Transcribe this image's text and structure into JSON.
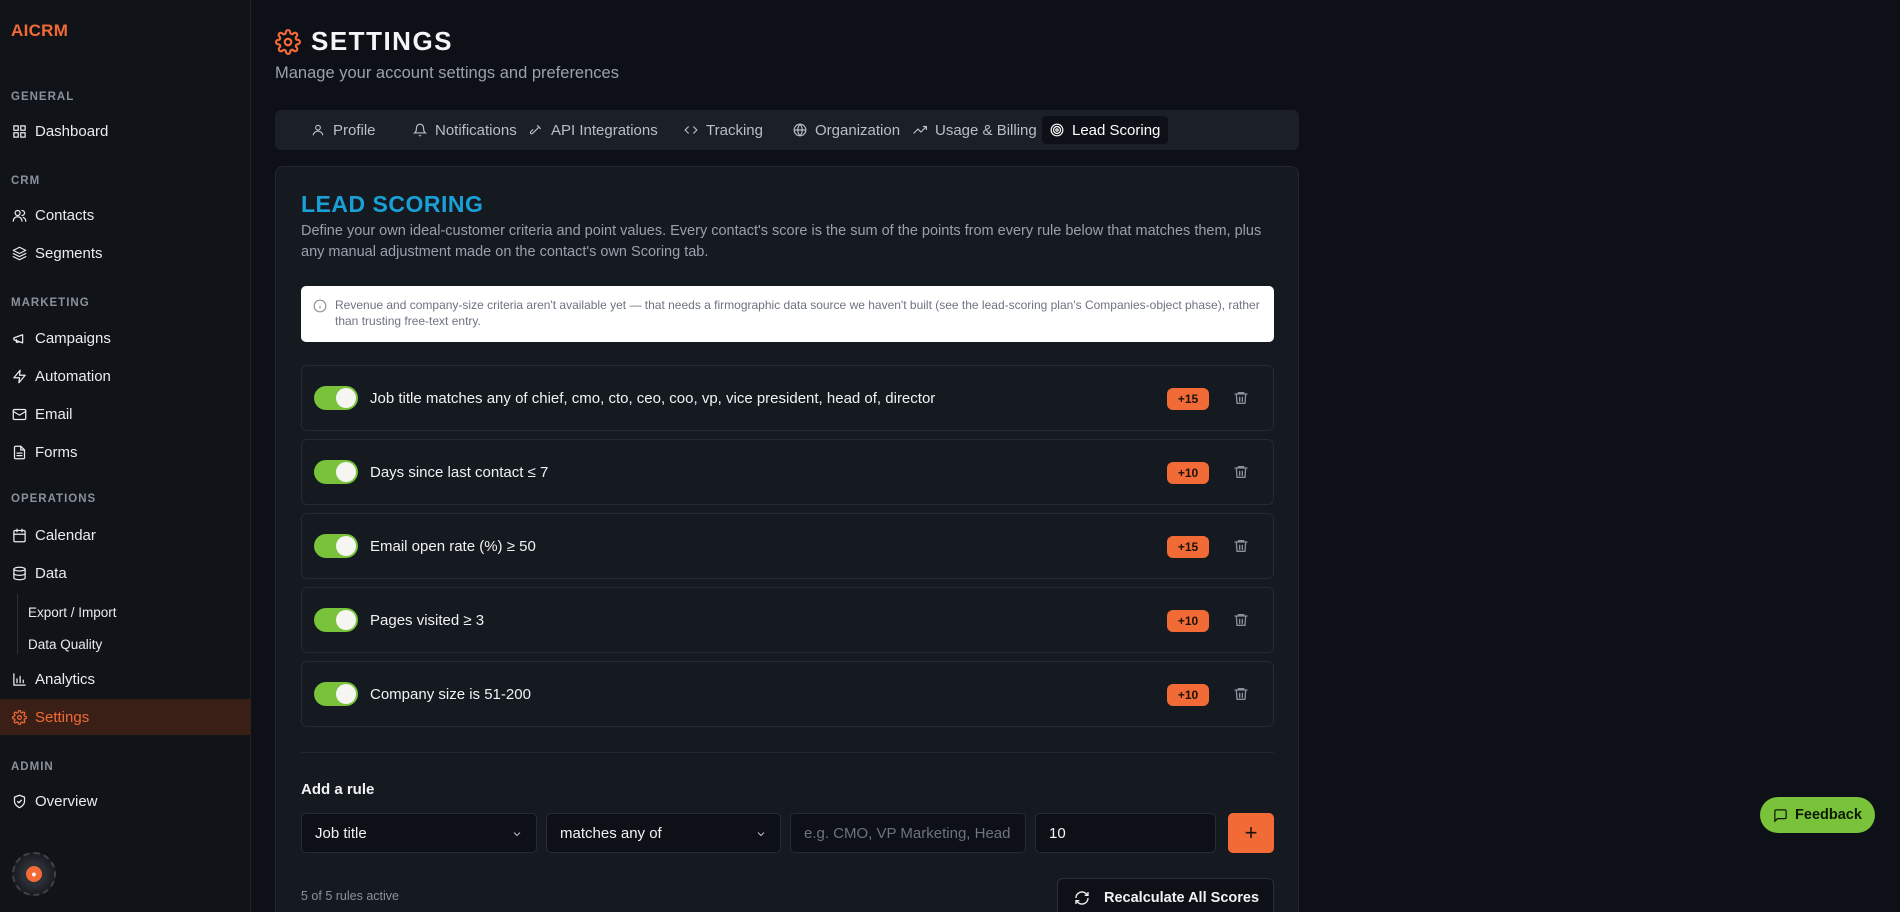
{
  "app": {
    "brand": "AICRM"
  },
  "sidebar": {
    "sections": {
      "general": "GENERAL",
      "crm": "CRM",
      "marketing": "MARKETING",
      "operations": "OPERATIONS",
      "admin": "ADMIN"
    },
    "items": {
      "dashboard": "Dashboard",
      "contacts": "Contacts",
      "segments": "Segments",
      "campaigns": "Campaigns",
      "automation": "Automation",
      "email": "Email",
      "forms": "Forms",
      "calendar": "Calendar",
      "data": "Data",
      "export_import": "Export / Import",
      "data_quality": "Data Quality",
      "analytics": "Analytics",
      "settings": "Settings",
      "overview": "Overview"
    },
    "active": "Settings"
  },
  "header": {
    "title": "SETTINGS",
    "subtitle": "Manage your account settings and preferences"
  },
  "tabs": [
    {
      "label": "Profile"
    },
    {
      "label": "Notifications"
    },
    {
      "label": "API Integrations"
    },
    {
      "label": "Tracking"
    },
    {
      "label": "Organization"
    },
    {
      "label": "Usage & Billing"
    },
    {
      "label": "Lead Scoring"
    }
  ],
  "active_tab": "Lead Scoring",
  "lead_scoring": {
    "title": "LEAD SCORING",
    "description": "Define your own ideal-customer criteria and point values. Every contact's score is the sum of the points from every rule below that matches them, plus any manual adjustment made on the contact's own Scoring tab.",
    "notice": "Revenue and company-size criteria aren't available yet — that needs a firmographic data source we haven't built (see the lead-scoring plan's Companies-object phase), rather than trusting free-text entry.",
    "rules": [
      {
        "text": "Job title matches any of chief, cmo, cto, ceo, coo, vp, vice president, head of, director",
        "points": "+15",
        "enabled": true
      },
      {
        "text": "Days since last contact ≤ 7",
        "points": "+10",
        "enabled": true
      },
      {
        "text": "Email open rate (%) ≥ 50",
        "points": "+15",
        "enabled": true
      },
      {
        "text": "Pages visited ≥ 3",
        "points": "+10",
        "enabled": true
      },
      {
        "text": "Company size is 51-200",
        "points": "+10",
        "enabled": true
      }
    ],
    "add_rule": {
      "label": "Add a rule",
      "field_value": "Job title",
      "operator_value": "matches any of",
      "value_placeholder": "e.g. CMO, VP Marketing, Head of...",
      "points_value": "10",
      "add_button": "+"
    },
    "rules_active": "5 of 5 rules active",
    "recalculate_label": "Recalculate All Scores"
  },
  "feedback_label": "Feedback",
  "colors": {
    "accent": "#f26a35",
    "title_blue": "#1aa0d8",
    "toggle_green": "#78c33a",
    "background": "#0d1016"
  }
}
